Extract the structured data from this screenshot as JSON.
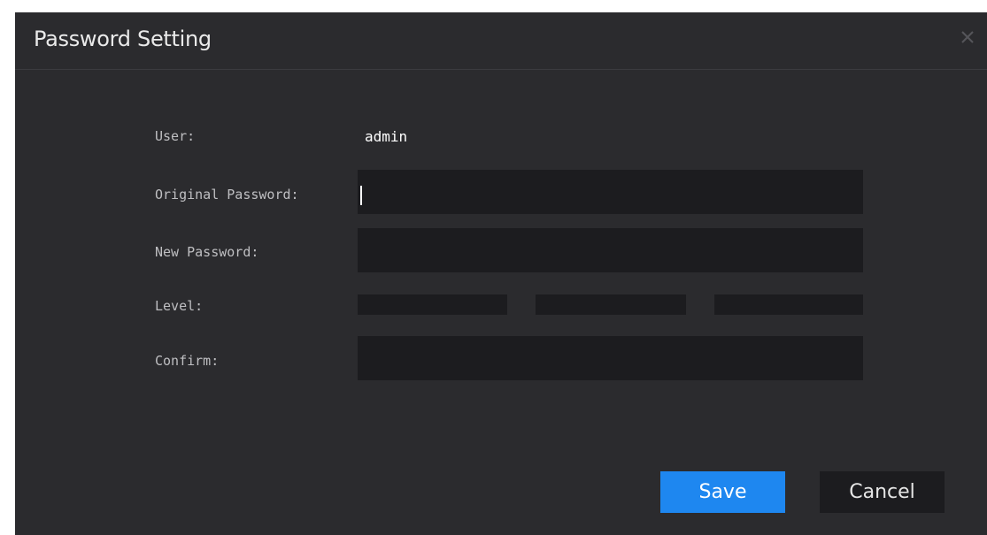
{
  "dialog": {
    "title": "Password Setting",
    "close_icon": "close-icon"
  },
  "form": {
    "user_label": "User:",
    "user_value": "admin",
    "original_password_label": "Original Password:",
    "original_password_value": "",
    "new_password_label": "New Password:",
    "new_password_value": "",
    "level_label": "Level:",
    "level_segments": 3,
    "level_active": 0,
    "confirm_label": "Confirm:",
    "confirm_value": ""
  },
  "buttons": {
    "save_label": "Save",
    "cancel_label": "Cancel"
  },
  "colors": {
    "dialog_bg": "#2b2b2e",
    "field_bg": "#1c1c1f",
    "accent": "#1e87f0"
  }
}
